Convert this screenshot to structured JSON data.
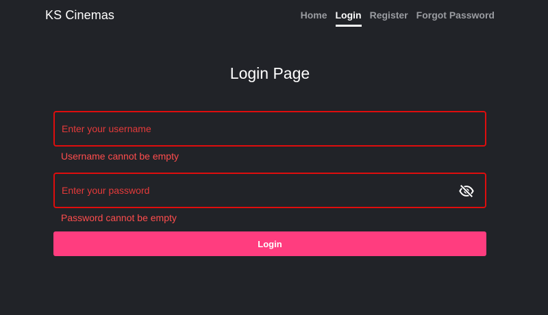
{
  "navbar": {
    "brand": "KS Cinemas",
    "links": [
      {
        "label": "Home",
        "active": false
      },
      {
        "label": "Login",
        "active": true
      },
      {
        "label": "Register",
        "active": false
      },
      {
        "label": "Forgot Password",
        "active": false
      }
    ]
  },
  "page": {
    "title": "Login Page"
  },
  "form": {
    "username": {
      "value": "",
      "placeholder": "Enter your username",
      "error": "Username cannot be empty"
    },
    "password": {
      "value": "",
      "placeholder": "Enter your password",
      "error": "Password cannot be empty",
      "toggle_icon": "eye-off-icon"
    },
    "submit_label": "Login"
  },
  "colors": {
    "background": "#212328",
    "error": "#e00d0d",
    "accent": "#ff3d7f",
    "nav_inactive": "#9a9ca1"
  }
}
